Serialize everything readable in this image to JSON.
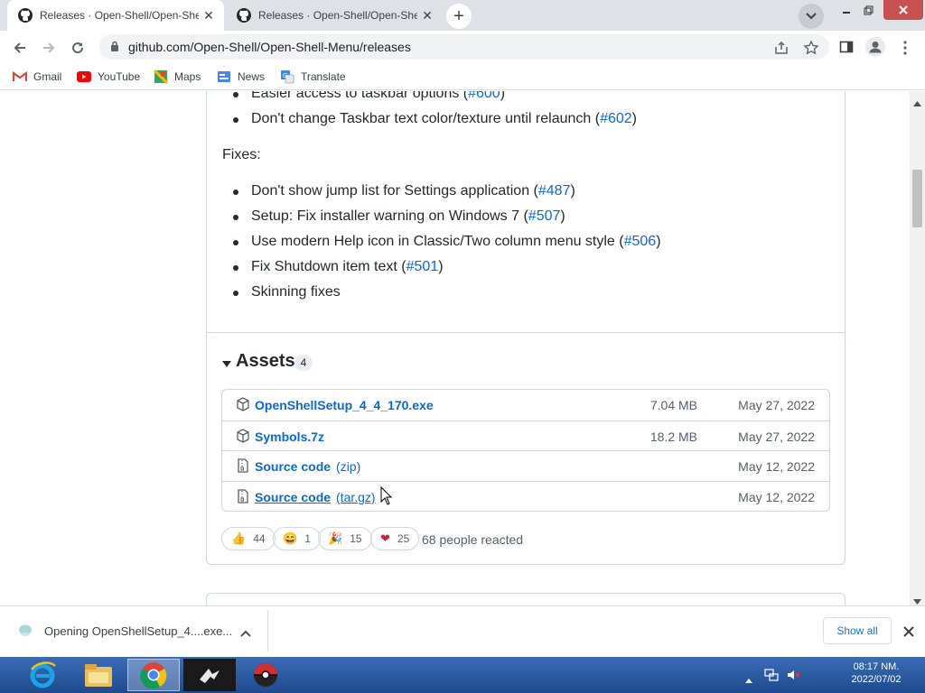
{
  "browser": {
    "tabs": [
      {
        "title": "Releases · Open-Shell/Open-She",
        "active": true
      },
      {
        "title": "Releases · Open-Shell/Open-She",
        "active": false
      }
    ],
    "new_tab": "+",
    "close_glyph": "✕",
    "url": "github.com/Open-Shell/Open-Shell-Menu/releases",
    "bookmarks": [
      "Gmail",
      "YouTube",
      "Maps",
      "News",
      "Translate"
    ]
  },
  "release": {
    "features_tail": [
      {
        "text": "Easier access to taskbar options (",
        "link": "#600",
        "close": ")"
      },
      {
        "text": "Don't change Taskbar text color/texture until relaunch (",
        "link": "#602",
        "close": ")"
      }
    ],
    "fixes_heading": "Fixes:",
    "fixes": [
      {
        "text": "Don't show jump list for Settings application (",
        "link": "#487",
        "close": ")"
      },
      {
        "text": "Setup: Fix installer warning on Windows 7 (",
        "link": "#507",
        "close": ")"
      },
      {
        "text": "Use modern Help icon in Classic/Two column menu style (",
        "link": "#506",
        "close": ")"
      },
      {
        "text": "Fix Shutdown item text (",
        "link": "#501",
        "close": ")"
      },
      {
        "text": "Skinning fixes",
        "link": "",
        "close": ""
      }
    ],
    "assets": {
      "title": "Assets",
      "count": "4",
      "items": [
        {
          "name": "OpenShellSetup_4_4_170.exe",
          "ext": "",
          "size": "7.04 MB",
          "date": "May 27, 2022",
          "icon": "package-icon"
        },
        {
          "name": "Symbols.7z",
          "ext": "",
          "size": "18.2 MB",
          "date": "May 27, 2022",
          "icon": "package-icon"
        },
        {
          "name": "Source code",
          "ext": "(zip)",
          "size": "",
          "date": "May 12, 2022",
          "icon": "file-zip-icon"
        },
        {
          "name": "Source code",
          "ext": "(tar.gz)",
          "size": "",
          "date": "May 12, 2022",
          "icon": "file-zip-icon"
        }
      ]
    },
    "reactions": [
      {
        "emoji": "👍",
        "count": "44"
      },
      {
        "emoji": "😄",
        "count": "1"
      },
      {
        "emoji": "🎉",
        "count": "15"
      },
      {
        "emoji": "❤",
        "count": "25"
      }
    ],
    "reacted_text": "68 people reacted"
  },
  "download": {
    "filename": "Opening OpenShellSetup_4....exe...",
    "show_all": "Show all"
  },
  "taskbar": {
    "time": "08:17 NM.",
    "date": "2022/07/02"
  }
}
